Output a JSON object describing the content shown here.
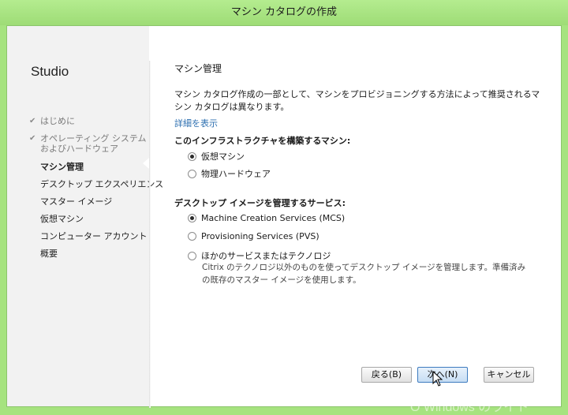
{
  "window": {
    "title": "マシン カタログの作成"
  },
  "sidebar": {
    "brand": "Studio",
    "steps": [
      {
        "label": "はじめに",
        "state": "done"
      },
      {
        "label": "オペレーティング システム",
        "label2": "およびハードウェア",
        "state": "done"
      },
      {
        "label": "マシン管理",
        "state": "current"
      },
      {
        "label": "デスクトップ エクスペリエンス",
        "state": "pending"
      },
      {
        "label": "マスター イメージ",
        "state": "pending"
      },
      {
        "label": "仮想マシン",
        "state": "pending"
      },
      {
        "label": "コンピューター アカウント",
        "state": "pending"
      },
      {
        "label": "概要",
        "state": "pending"
      }
    ]
  },
  "main": {
    "title": "マシン管理",
    "description": "マシン カタログ作成の一部として、マシンをプロビジョニングする方法によって推奨されるマシン カタログは異なります。",
    "details_link": "詳細を表示",
    "infra_section": {
      "heading": "このインフラストラクチャを構築するマシン:",
      "options": [
        {
          "label": "仮想マシン",
          "selected": true
        },
        {
          "label": "物理ハードウェア",
          "selected": false
        }
      ]
    },
    "image_section": {
      "heading": "デスクトップ イメージを管理するサービス:",
      "options": [
        {
          "label": "Machine Creation Services (MCS)",
          "selected": true
        },
        {
          "label": "Provisioning Services (PVS)",
          "selected": false
        },
        {
          "label": "ほかのサービスまたはテクノロジ",
          "selected": false,
          "note": "Citrix のテクノロジ以外のものを使ってデスクトップ イメージを管理します。準備済みの既存のマスター イメージを使用します。"
        }
      ]
    }
  },
  "footer": {
    "back_label": "戻る(B)",
    "next_label": "次へ(N)",
    "cancel_label": "キャンセル"
  },
  "watermark": "O  Windows のライト",
  "colors": {
    "window_frame": "#a6e37f",
    "link": "#2d6fb0",
    "primary_button_border": "#3d7bbf"
  }
}
